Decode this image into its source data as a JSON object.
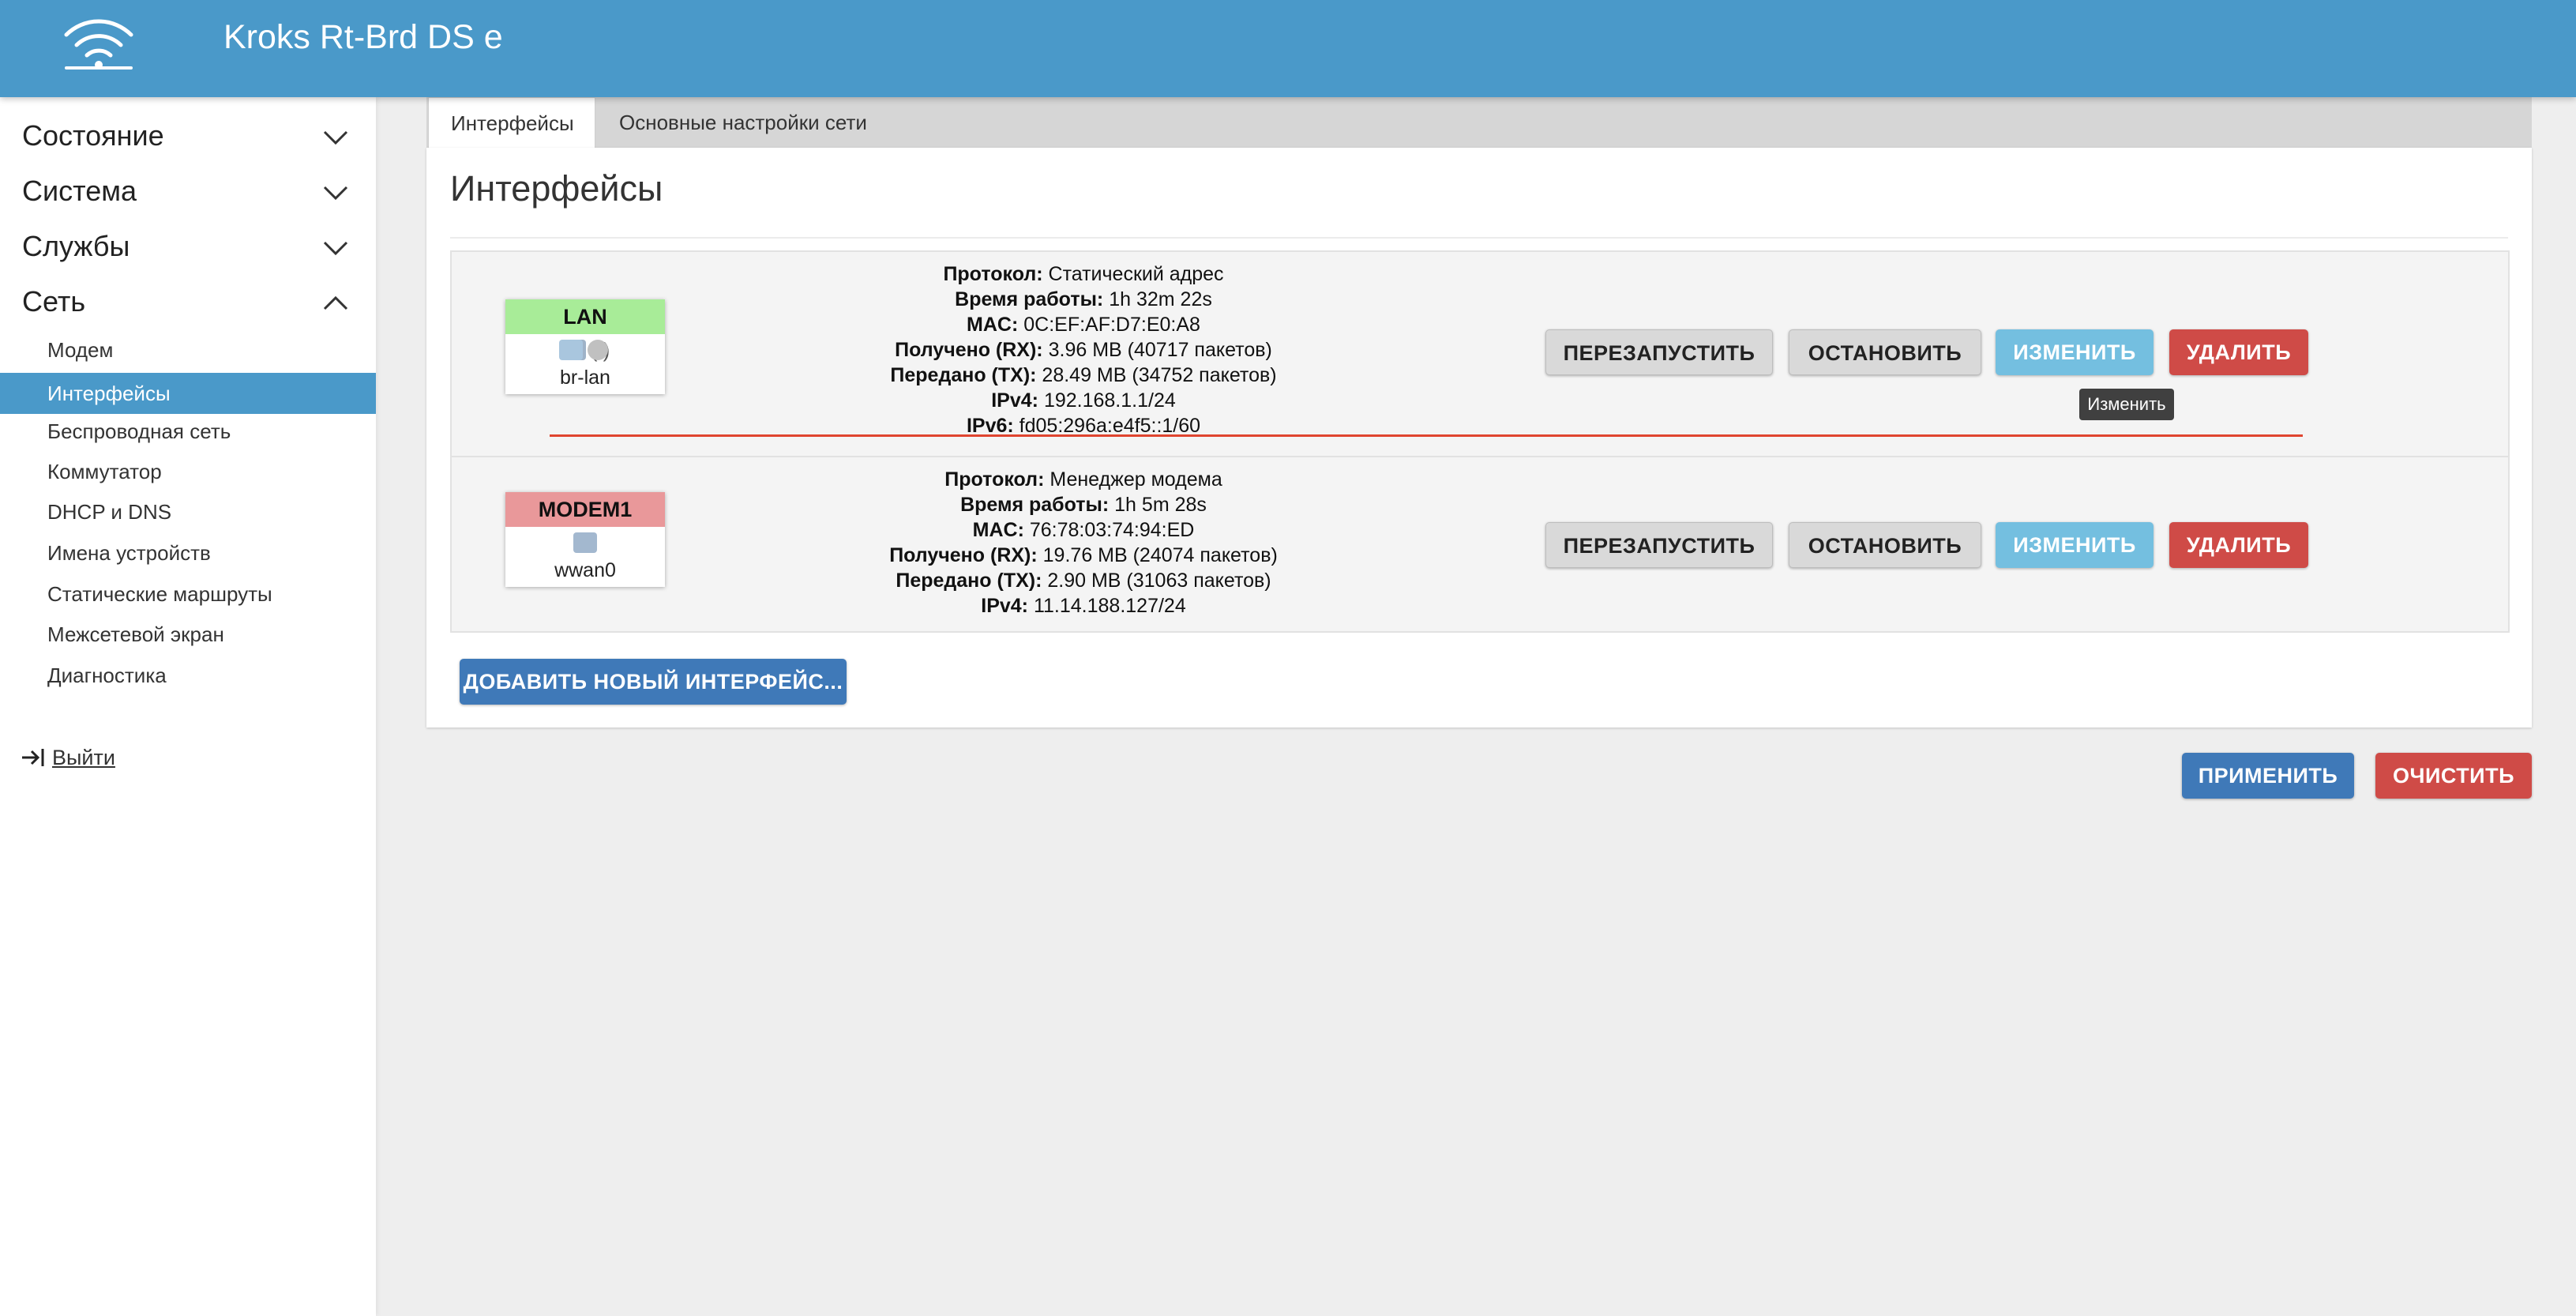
{
  "header": {
    "brand": "Kroks Rt-Brd DS e",
    "logo_icon": "wifi-icon"
  },
  "sidebar": {
    "sections": [
      {
        "label": "Состояние",
        "expanded": false
      },
      {
        "label": "Система",
        "expanded": false
      },
      {
        "label": "Службы",
        "expanded": false
      },
      {
        "label": "Сеть",
        "expanded": true
      }
    ],
    "network_items": [
      {
        "label": "Модем",
        "active": false
      },
      {
        "label": "Интерфейсы",
        "active": true
      },
      {
        "label": "Беспроводная сеть",
        "active": false
      },
      {
        "label": "Коммутатор",
        "active": false
      },
      {
        "label": "DHCP и DNS",
        "active": false
      },
      {
        "label": "Имена устройств",
        "active": false
      },
      {
        "label": "Статические маршруты",
        "active": false
      },
      {
        "label": "Межсетевой экран",
        "active": false
      },
      {
        "label": "Диагностика",
        "active": false
      }
    ],
    "logout": "Выйти"
  },
  "tabs": [
    {
      "label": "Интерфейсы",
      "active": true
    },
    {
      "label": "Основные настройки сети",
      "active": false
    }
  ],
  "page_title": "Интерфейсы",
  "interfaces": [
    {
      "name": "LAN",
      "color": "#a8ec98",
      "device": "br-lan",
      "icons_text": "( )",
      "info": [
        {
          "label": "Протокол:",
          "value": "Статический адрес"
        },
        {
          "label": "Время работы:",
          "value": "1h 32m 22s"
        },
        {
          "label": "MAC:",
          "value": "0C:EF:AF:D7:E0:A8"
        },
        {
          "label": "Получено (RX):",
          "value": "3.96 MB (40717 пакетов)"
        },
        {
          "label": "Передано (TX):",
          "value": "28.49 MB (34752 пакетов)"
        },
        {
          "label": "IPv4:",
          "value": "192.168.1.1/24"
        },
        {
          "label": "IPv6:",
          "value": "fd05:296a:e4f5::1/60"
        }
      ]
    },
    {
      "name": "MODEM1",
      "color": "#e9989a",
      "device": "wwan0",
      "info": [
        {
          "label": "Протокол:",
          "value": "Менеджер модема"
        },
        {
          "label": "Время работы:",
          "value": "1h 5m 28s"
        },
        {
          "label": "MAC:",
          "value": "76:78:03:74:94:ED"
        },
        {
          "label": "Получено (RX):",
          "value": "19.76 MB (24074 пакетов)"
        },
        {
          "label": "Передано (TX):",
          "value": "2.90 MB (31063 пакетов)"
        },
        {
          "label": "IPv4:",
          "value": "11.14.188.127/24"
        }
      ]
    }
  ],
  "row_buttons": {
    "restart": "ПЕРЕЗАПУСТИТЬ",
    "stop": "ОСТАНОВИТЬ",
    "edit": "ИЗМЕНИТЬ",
    "delete": "УДАЛИТЬ"
  },
  "tooltip": "Изменить",
  "add_button": "ДОБАВИТЬ НОВЫЙ ИНТЕРФЕЙС...",
  "apply_button": "ПРИМЕНИТЬ",
  "reset_button": "ОЧИСТИТЬ"
}
